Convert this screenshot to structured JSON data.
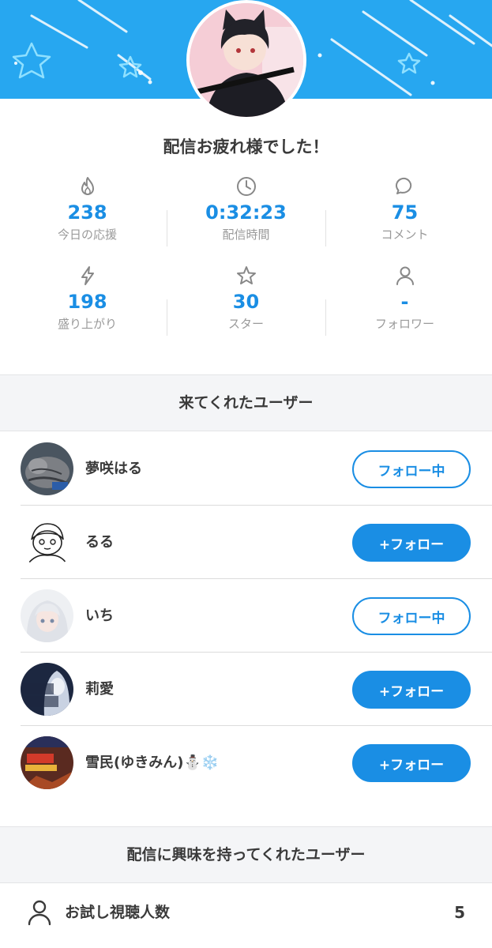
{
  "header": {
    "title": "配信お疲れ様でした！",
    "banner_color": "#27a7f0"
  },
  "stats": [
    {
      "icon": "flame-icon",
      "value": "238",
      "label": "今日の応援"
    },
    {
      "icon": "clock-icon",
      "value": "0:32:23",
      "label": "配信時間"
    },
    {
      "icon": "comment-icon",
      "value": "75",
      "label": "コメント"
    },
    {
      "icon": "lightning-icon",
      "value": "198",
      "label": "盛り上がり"
    },
    {
      "icon": "star-icon",
      "value": "30",
      "label": "スター"
    },
    {
      "icon": "person-icon",
      "value": "-",
      "label": "フォロワー"
    }
  ],
  "visitors": {
    "heading": "来てくれたユーザー",
    "users": [
      {
        "name": "夢咲はる",
        "button": "フォロー中",
        "state": "following"
      },
      {
        "name": "るる",
        "button": "+フォロー",
        "state": "follow"
      },
      {
        "name": "いち",
        "button": "フォロー中",
        "state": "following"
      },
      {
        "name": "莉愛",
        "button": "+フォロー",
        "state": "follow"
      },
      {
        "name": "雪民(ゆきみん)⛄❄️",
        "button": "+フォロー",
        "state": "follow"
      }
    ]
  },
  "interested": {
    "heading": "配信に興味を持ってくれたユーザー",
    "trial_label": "お試し視聴人数",
    "trial_count": "5"
  },
  "colors": {
    "accent": "#1a8ee4",
    "label_gray": "#9a9a9a"
  }
}
